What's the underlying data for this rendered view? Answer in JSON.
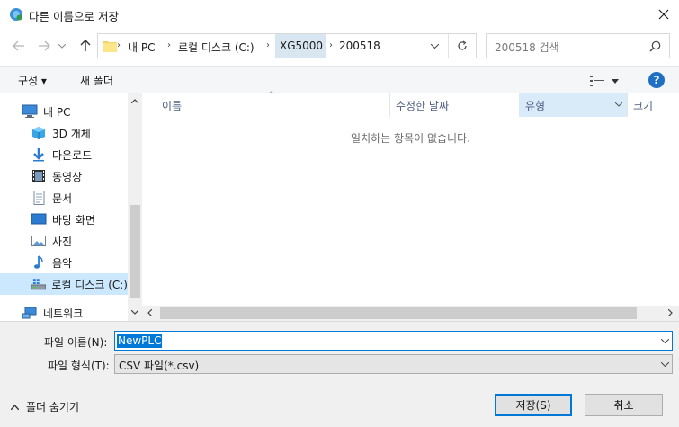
{
  "window": {
    "title": "다른 이름으로 저장"
  },
  "address": {
    "breadcrumbs": [
      "내 PC",
      "로컬 디스크 (C:)",
      "XG5000",
      "200518"
    ]
  },
  "search": {
    "placeholder": "200518 검색"
  },
  "toolbar": {
    "organize": "구성 ▾",
    "new_folder": "새 폴더"
  },
  "sidebar": {
    "items": [
      {
        "label": "내 PC",
        "icon": "pc-icon"
      },
      {
        "label": "3D 개체",
        "icon": "3d-objects-icon"
      },
      {
        "label": "다운로드",
        "icon": "download-icon"
      },
      {
        "label": "동영상",
        "icon": "video-icon"
      },
      {
        "label": "문서",
        "icon": "document-icon"
      },
      {
        "label": "바탕 화면",
        "icon": "desktop-icon"
      },
      {
        "label": "사진",
        "icon": "picture-icon"
      },
      {
        "label": "음악",
        "icon": "music-icon"
      },
      {
        "label": "로컬 디스크 (C:)",
        "icon": "drive-icon"
      },
      {
        "label": "네트워크",
        "icon": "network-icon"
      }
    ]
  },
  "columns": [
    "이름",
    "수정한 날짜",
    "유형",
    "크기"
  ],
  "empty_message": "일치하는 항목이 없습니다.",
  "form": {
    "filename_label": "파일 이름(N):",
    "filename_value": "NewPLC",
    "filetype_label": "파일 형식(T):",
    "filetype_value": "CSV 파일(*.csv)",
    "hide_folders": "폴더 숨기기",
    "save_button": "저장(S)",
    "cancel_button": "취소"
  },
  "colors": {
    "accent": "#0078d7",
    "selection": "#cce8ff",
    "header_text": "#4d6082"
  }
}
